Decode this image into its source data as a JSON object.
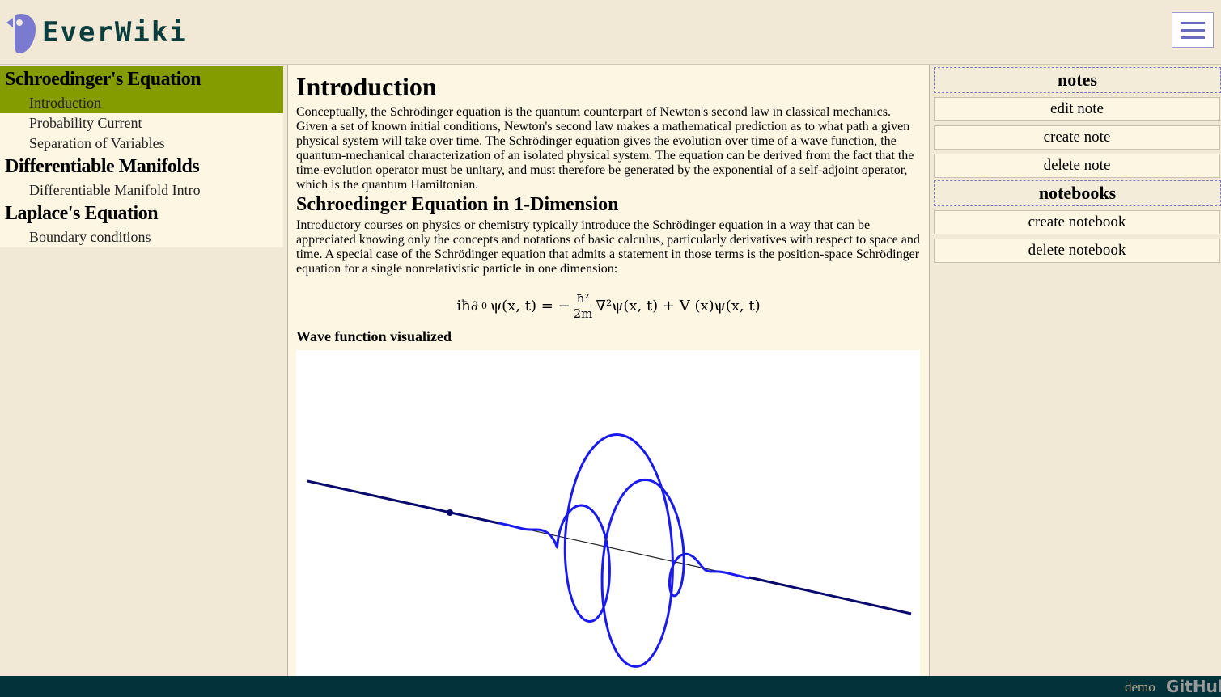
{
  "app": {
    "title": "EverWiki"
  },
  "nav": {
    "groups": [
      {
        "title": "Schroedinger's Equation",
        "items": [
          "Introduction",
          "Probability Current",
          "Separation of Variables"
        ]
      },
      {
        "title": "Differentiable Manifolds",
        "items": [
          "Differentiable Manifold Intro"
        ]
      },
      {
        "title": "Laplace's Equation",
        "items": [
          "Boundary conditions"
        ]
      }
    ],
    "active_group": "Schroedinger's Equation",
    "active_item": "Introduction"
  },
  "main": {
    "title": "Introduction",
    "intro_paragraph": "Conceptually, the Schrödinger equation is the quantum counterpart of Newton's second law in classical mechanics. Given a set of known initial conditions, Newton's second law makes a mathematical prediction as to what path a given physical system will take over time. The Schrödinger equation gives the evolution over time of a wave function, the quantum-mechanical characterization of an isolated physical system. The equation can be derived from the fact that the time-evolution operator must be unitary, and must therefore be generated by the exponential of a self-adjoint operator, which is the quantum Hamiltonian.",
    "section_title": "Schroedinger Equation in 1-Dimension",
    "section_paragraph": "Introductory courses on physics or chemistry typically introduce the Schrödinger equation in a way that can be appreciated knowing only the concepts and notations of basic calculus, particularly derivatives with respect to space and time. A special case of the Schrödinger equation that admits a statement in those terms is the position-space Schrödinger equation for a single nonrelativistic particle in one dimension:",
    "formula": {
      "lhs": "iħ∂",
      "lhs_sub": "0",
      "lhs_rest": "ψ(x, t) = −",
      "frac_num": "ħ²",
      "frac_den": "2m",
      "rhs": "∇²ψ(x, t) + V (x)ψ(x, t)"
    },
    "viz_title": "Wave function visualized"
  },
  "right_panel": {
    "notes_heading": "notes",
    "notes_buttons": [
      "edit note",
      "create note",
      "delete note"
    ],
    "notebooks_heading": "notebooks",
    "notebooks_buttons": [
      "create notebook",
      "delete notebook"
    ]
  },
  "footer": {
    "demo_label": "demo",
    "github_label": "GitHub"
  },
  "colors": {
    "active_nav": "#849c00",
    "wave_color": "#1a1aee",
    "axis_color": "#0a0a6e",
    "footer_bg": "#03323a"
  }
}
